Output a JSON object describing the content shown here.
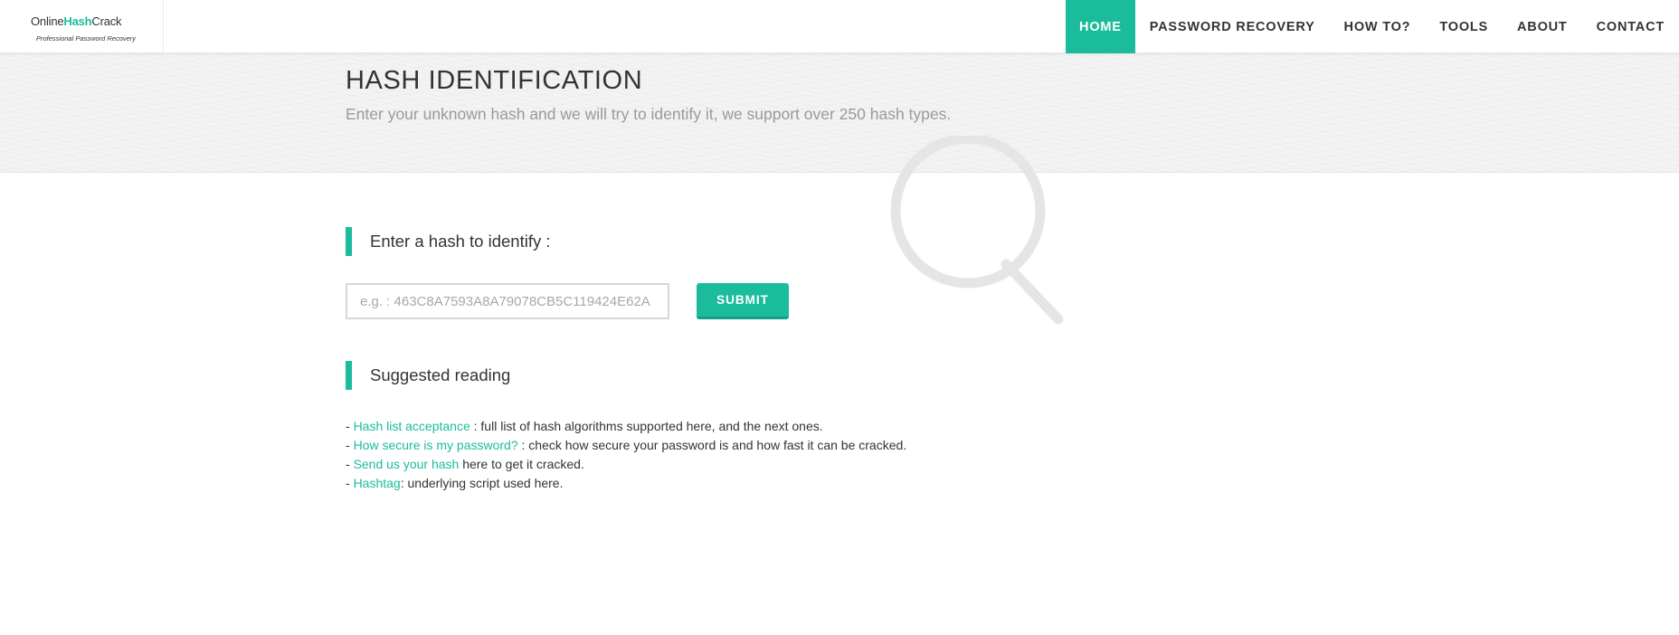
{
  "brand": {
    "name_part1": "Online",
    "name_part2": "Hash",
    "name_part3": "Crack",
    "tagline": "Professional Password Recovery",
    "accent_color": "#1abc9c"
  },
  "nav": {
    "items": [
      {
        "label": "HOME",
        "active": true
      },
      {
        "label": "PASSWORD RECOVERY",
        "active": false
      },
      {
        "label": "HOW TO?",
        "active": false
      },
      {
        "label": "TOOLS",
        "active": false
      },
      {
        "label": "ABOUT",
        "active": false
      },
      {
        "label": "CONTACT",
        "active": false
      }
    ]
  },
  "header": {
    "title": "HASH IDENTIFICATION",
    "subtitle": "Enter your unknown hash and we will try to identify it, we support over 250 hash types."
  },
  "form": {
    "heading": "Enter a hash to identify :",
    "input_value": "",
    "input_placeholder": "e.g. : 463C8A7593A8A79078CB5C119424E62A",
    "submit_label": "SUBMIT"
  },
  "reading": {
    "heading": "Suggested reading",
    "items": [
      {
        "prefix": "- ",
        "link": "Hash list acceptance",
        "text": " : full list of hash algorithms supported here, and the next ones."
      },
      {
        "prefix": "- ",
        "link": "How secure is my password?",
        "text": " : check how secure your password is and how fast it can be cracked."
      },
      {
        "prefix": "- ",
        "link": "Send us your hash",
        "text": " here to get it cracked."
      },
      {
        "prefix": "- ",
        "link": "Hashtag",
        "text": ": underlying script used here."
      }
    ]
  },
  "icons": {
    "background": "magnifier-icon"
  }
}
